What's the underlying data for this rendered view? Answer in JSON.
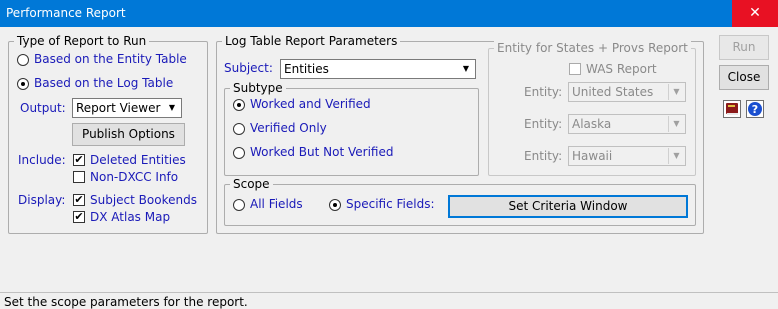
{
  "window": {
    "title": "Performance Report",
    "close_glyph": "✕"
  },
  "report_type": {
    "legend": "Type of Report to Run",
    "entity_option": "Based on the Entity Table",
    "log_option": "Based on the Log Table",
    "selected": "log"
  },
  "output": {
    "label": "Output:",
    "value": "Report Viewer"
  },
  "publish_button": "Publish Options",
  "include": {
    "label": "Include:",
    "deleted_entities": {
      "label": "Deleted Entities",
      "checked": true
    },
    "non_dxcc": {
      "label": "Non-DXCC Info",
      "checked": false
    }
  },
  "display": {
    "label": "Display:",
    "subject_bookends": {
      "label": "Subject Bookends",
      "checked": true
    },
    "dx_atlas": {
      "label": "DX Atlas Map",
      "checked": true
    }
  },
  "log_params": {
    "legend": "Log Table Report Parameters",
    "subject_label": "Subject:",
    "subject_value": "Entities"
  },
  "subtype": {
    "legend": "Subtype",
    "worked_verified": "Worked and Verified",
    "verified_only": "Verified Only",
    "worked_not_verified": "Worked But Not Verified",
    "selected": "worked_verified"
  },
  "entity_states": {
    "legend": "Entity for States + Provs Report",
    "was_report": "WAS Report",
    "entity_label": "Entity:",
    "entities": [
      "United States",
      "Alaska",
      "Hawaii"
    ]
  },
  "scope": {
    "legend": "Scope",
    "all_fields": "All Fields",
    "specific_fields": "Specific Fields:",
    "selected": "specific",
    "criteria_button": "Set Criteria Window"
  },
  "buttons": {
    "run": "Run",
    "close": "Close"
  },
  "icons": [
    "book-icon",
    "help-icon"
  ],
  "status": "Set the scope parameters for the report."
}
